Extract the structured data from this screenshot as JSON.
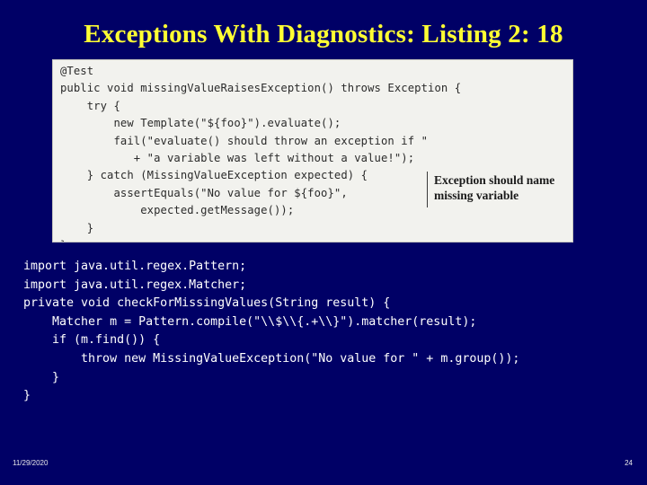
{
  "slide": {
    "title": "Exceptions With Diagnostics: Listing 2: 18",
    "title_color": "#ffff33",
    "background_color": "#000066"
  },
  "code_image": {
    "lines": "@Test\npublic void missingValueRaisesException() throws Exception {\n    try {\n        new Template(\"${foo}\").evaluate();\n        fail(\"evaluate() should throw an exception if \"\n           + \"a variable was left without a value!\");\n    } catch (MissingValueException expected) {\n        assertEquals(\"No value for ${foo}\",\n            expected.getMessage());\n    }\n}",
    "annotation": "Exception should name missing variable"
  },
  "code_text": {
    "lines": "import java.util.regex.Pattern;\nimport java.util.regex.Matcher;\nprivate void checkForMissingValues(String result) {\n    Matcher m = Pattern.compile(\"\\\\$\\\\{.+\\\\}\").matcher(result);\n    if (m.find()) {\n        throw new MissingValueException(\"No value for \" + m.group());\n    }\n}"
  },
  "footer": {
    "date": "11/29/2020",
    "page_number": "24"
  }
}
